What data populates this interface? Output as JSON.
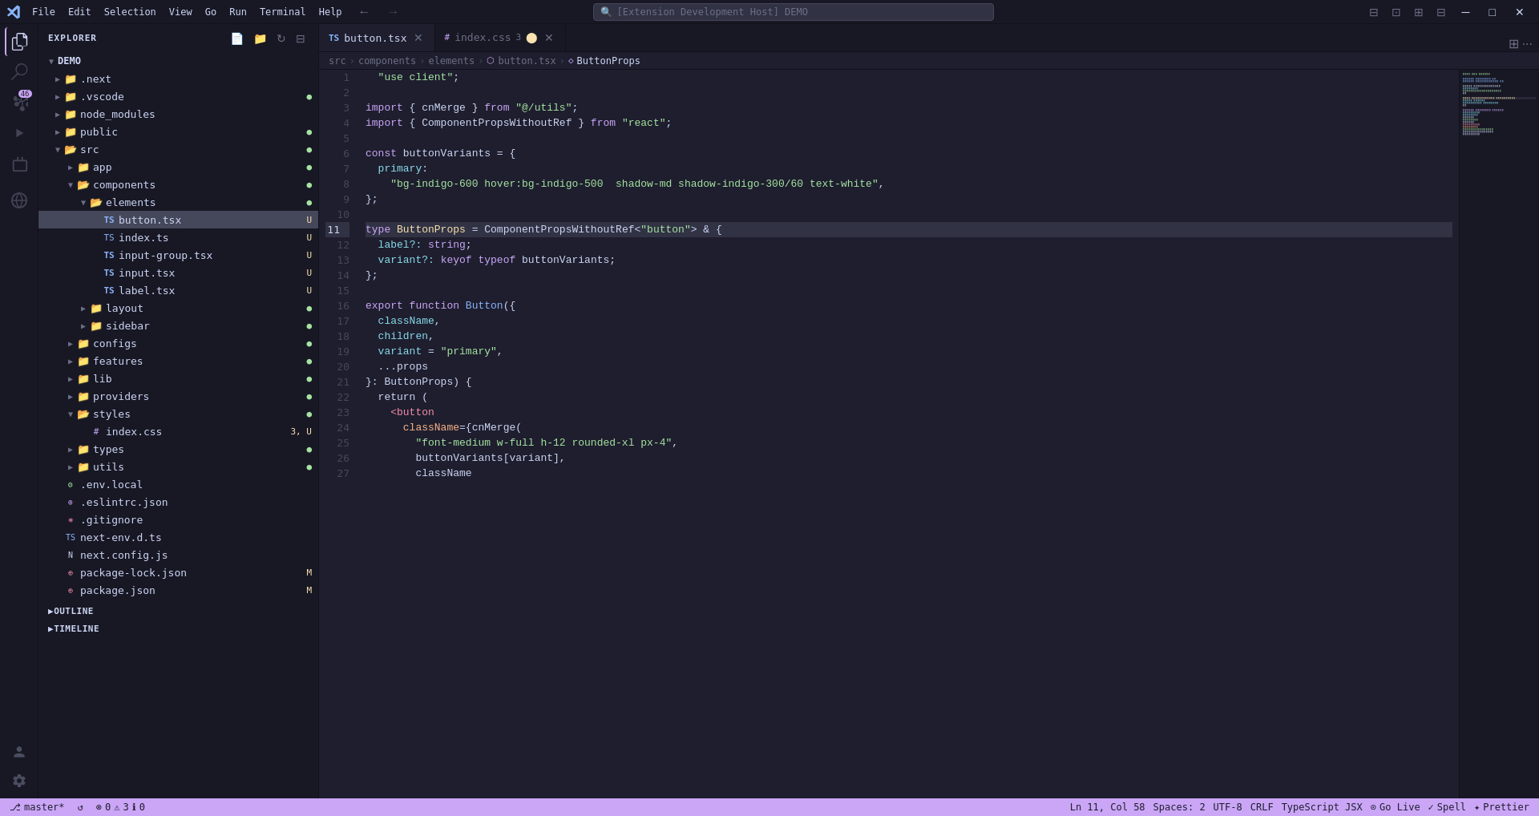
{
  "titlebar": {
    "menu_items": [
      "File",
      "Edit",
      "Selection",
      "View",
      "Go",
      "Run",
      "Terminal",
      "Help"
    ],
    "search_placeholder": "[Extension Development Host] DEMO",
    "nav_back": "←",
    "nav_forward": "→"
  },
  "activity_bar": {
    "icons": [
      {
        "name": "explorer-icon",
        "symbol": "⎘",
        "active": true,
        "badge": null
      },
      {
        "name": "search-icon",
        "symbol": "🔍",
        "active": false,
        "badge": null
      },
      {
        "name": "source-control-icon",
        "symbol": "⎇",
        "active": false,
        "badge": "46"
      },
      {
        "name": "run-debug-icon",
        "symbol": "▷",
        "active": false,
        "badge": null
      },
      {
        "name": "extensions-icon",
        "symbol": "⊞",
        "active": false,
        "badge": null
      },
      {
        "name": "remote-explorer-icon",
        "symbol": "⊡",
        "active": false,
        "badge": null
      }
    ],
    "bottom_icons": [
      {
        "name": "account-icon",
        "symbol": "👤"
      },
      {
        "name": "settings-icon",
        "symbol": "⚙"
      }
    ]
  },
  "sidebar": {
    "title": "EXPLORER",
    "root": "DEMO",
    "tree": [
      {
        "id": "next",
        "label": ".next",
        "type": "folder",
        "indent": 1,
        "expanded": false,
        "badge": ""
      },
      {
        "id": "vscode",
        "label": ".vscode",
        "type": "folder",
        "indent": 1,
        "expanded": false,
        "badge": "●",
        "badge_class": "badge-green"
      },
      {
        "id": "node_modules",
        "label": "node_modules",
        "type": "folder",
        "indent": 1,
        "expanded": false,
        "badge": ""
      },
      {
        "id": "public",
        "label": "public",
        "type": "folder",
        "indent": 1,
        "expanded": false,
        "badge": "●",
        "badge_class": "badge-green"
      },
      {
        "id": "src",
        "label": "src",
        "type": "folder",
        "indent": 1,
        "expanded": true,
        "badge": "●",
        "badge_class": "badge-green"
      },
      {
        "id": "app",
        "label": "app",
        "type": "folder",
        "indent": 2,
        "expanded": false,
        "badge": "●",
        "badge_class": "badge-green"
      },
      {
        "id": "components",
        "label": "components",
        "type": "folder",
        "indent": 2,
        "expanded": true,
        "badge": "●",
        "badge_class": "badge-green"
      },
      {
        "id": "elements",
        "label": "elements",
        "type": "folder",
        "indent": 3,
        "expanded": true,
        "badge": "●",
        "badge_class": "badge-green"
      },
      {
        "id": "button_tsx",
        "label": "button.tsx",
        "type": "tsx",
        "indent": 4,
        "expanded": false,
        "badge": "U",
        "badge_class": "badge-yellow"
      },
      {
        "id": "index_ts",
        "label": "index.ts",
        "type": "ts",
        "indent": 4,
        "expanded": false,
        "badge": "U",
        "badge_class": "badge-yellow"
      },
      {
        "id": "input_group_tsx",
        "label": "input-group.tsx",
        "type": "tsx",
        "indent": 4,
        "expanded": false,
        "badge": "U",
        "badge_class": "badge-yellow"
      },
      {
        "id": "input_tsx",
        "label": "input.tsx",
        "type": "tsx",
        "indent": 4,
        "expanded": false,
        "badge": "U",
        "badge_class": "badge-yellow"
      },
      {
        "id": "label_tsx",
        "label": "label.tsx",
        "type": "tsx",
        "indent": 4,
        "expanded": false,
        "badge": "U",
        "badge_class": "badge-yellow"
      },
      {
        "id": "layout",
        "label": "layout",
        "type": "folder",
        "indent": 3,
        "expanded": false,
        "badge": "●",
        "badge_class": "badge-green"
      },
      {
        "id": "sidebar_dir",
        "label": "sidebar",
        "type": "folder",
        "indent": 3,
        "expanded": false,
        "badge": "●",
        "badge_class": "badge-green"
      },
      {
        "id": "configs",
        "label": "configs",
        "type": "folder",
        "indent": 2,
        "expanded": false,
        "badge": "●",
        "badge_class": "badge-green"
      },
      {
        "id": "features",
        "label": "features",
        "type": "folder",
        "indent": 2,
        "expanded": false,
        "badge": "●",
        "badge_class": "badge-green"
      },
      {
        "id": "lib",
        "label": "lib",
        "type": "folder",
        "indent": 2,
        "expanded": false,
        "badge": "●",
        "badge_class": "badge-green"
      },
      {
        "id": "providers",
        "label": "providers",
        "type": "folder",
        "indent": 2,
        "expanded": false,
        "badge": "●",
        "badge_class": "badge-green"
      },
      {
        "id": "styles",
        "label": "styles",
        "type": "folder",
        "indent": 2,
        "expanded": true,
        "badge": "●",
        "badge_class": "badge-green"
      },
      {
        "id": "index_css",
        "label": "index.css",
        "type": "css",
        "indent": 3,
        "expanded": false,
        "badge": "3, U",
        "badge_class": "badge-yellow"
      },
      {
        "id": "types",
        "label": "types",
        "type": "folder",
        "indent": 2,
        "expanded": false,
        "badge": "●",
        "badge_class": "badge-green"
      },
      {
        "id": "utils",
        "label": "utils",
        "type": "folder",
        "indent": 2,
        "expanded": false,
        "badge": "●",
        "badge_class": "badge-green"
      },
      {
        "id": "env_local",
        "label": ".env.local",
        "type": "env",
        "indent": 1,
        "expanded": false,
        "badge": ""
      },
      {
        "id": "eslintrc",
        "label": ".eslintrc.json",
        "type": "json",
        "indent": 1,
        "expanded": false,
        "badge": ""
      },
      {
        "id": "gitignore",
        "label": ".gitignore",
        "type": "git",
        "indent": 1,
        "expanded": false,
        "badge": ""
      },
      {
        "id": "next_env",
        "label": "next-env.d.ts",
        "type": "ts",
        "indent": 1,
        "expanded": false,
        "badge": ""
      },
      {
        "id": "next_config",
        "label": "next.config.js",
        "type": "next",
        "indent": 1,
        "expanded": false,
        "badge": ""
      },
      {
        "id": "package_lock",
        "label": "package-lock.json",
        "type": "json",
        "indent": 1,
        "expanded": false,
        "badge": "M",
        "badge_class": "badge-yellow"
      },
      {
        "id": "package_json",
        "label": "package.json",
        "type": "json",
        "indent": 1,
        "expanded": false,
        "badge": "M",
        "badge_class": "badge-yellow"
      }
    ],
    "sections": [
      {
        "id": "outline",
        "label": "OUTLINE"
      },
      {
        "id": "timeline",
        "label": "TIMELINE"
      }
    ]
  },
  "tabs": [
    {
      "id": "button_tsx_tab",
      "label": "button.tsx",
      "type": "tsx",
      "active": true,
      "modified": false,
      "dirty": true
    },
    {
      "id": "index_css_tab",
      "label": "index.css",
      "type": "css",
      "active": false,
      "modified": true,
      "dirty": true,
      "count": "3"
    }
  ],
  "breadcrumb": {
    "items": [
      "src",
      "components",
      "elements",
      "button.tsx",
      "ButtonProps"
    ]
  },
  "code": {
    "highlighted_line": 11,
    "lines": [
      {
        "num": 1,
        "tokens": [
          {
            "text": "  \"use client\";",
            "class": "s-string"
          }
        ]
      },
      {
        "num": 2,
        "tokens": []
      },
      {
        "num": 3,
        "tokens": [
          {
            "text": "import ",
            "class": "s-keyword"
          },
          {
            "text": "{ cnMerge } ",
            "class": "s-plain"
          },
          {
            "text": "from ",
            "class": "s-keyword"
          },
          {
            "text": "\"@/utils\"",
            "class": "s-string"
          },
          {
            "text": ";",
            "class": "s-plain"
          }
        ]
      },
      {
        "num": 4,
        "tokens": [
          {
            "text": "import ",
            "class": "s-keyword"
          },
          {
            "text": "{ ComponentPropsWithoutRef } ",
            "class": "s-plain"
          },
          {
            "text": "from ",
            "class": "s-keyword"
          },
          {
            "text": "\"react\"",
            "class": "s-string"
          },
          {
            "text": ";",
            "class": "s-plain"
          }
        ]
      },
      {
        "num": 5,
        "tokens": []
      },
      {
        "num": 6,
        "tokens": [
          {
            "text": "const ",
            "class": "s-keyword"
          },
          {
            "text": "buttonVariants ",
            "class": "s-variable"
          },
          {
            "text": "= {",
            "class": "s-plain"
          }
        ]
      },
      {
        "num": 7,
        "tokens": [
          {
            "text": "  primary",
            "class": "s-property"
          },
          {
            "text": ":",
            "class": "s-plain"
          }
        ]
      },
      {
        "num": 8,
        "tokens": [
          {
            "text": "    \"bg-indigo-600 hover:bg-indigo-500  shadow-md shadow-indigo-300/60 text-white\"",
            "class": "s-string"
          },
          {
            "text": ",",
            "class": "s-plain"
          }
        ]
      },
      {
        "num": 9,
        "tokens": [
          {
            "text": "};",
            "class": "s-plain"
          }
        ]
      },
      {
        "num": 10,
        "tokens": []
      },
      {
        "num": 11,
        "tokens": [
          {
            "text": "type ",
            "class": "s-keyword"
          },
          {
            "text": "ButtonProps ",
            "class": "s-type"
          },
          {
            "text": "= ComponentPropsWithoutRef",
            "class": "s-plain"
          },
          {
            "text": "<\"button\"> & {",
            "class": "s-plain"
          }
        ]
      },
      {
        "num": 12,
        "tokens": [
          {
            "text": "  label",
            "class": "s-property"
          },
          {
            "text": "?: ",
            "class": "s-operator"
          },
          {
            "text": "string",
            "class": "s-keyword"
          },
          {
            "text": ";",
            "class": "s-plain"
          }
        ]
      },
      {
        "num": 13,
        "tokens": [
          {
            "text": "  variant",
            "class": "s-property"
          },
          {
            "text": "?: ",
            "class": "s-operator"
          },
          {
            "text": "keyof ",
            "class": "s-keyword"
          },
          {
            "text": "typeof ",
            "class": "s-keyword"
          },
          {
            "text": "buttonVariants",
            "class": "s-variable"
          },
          {
            "text": ";",
            "class": "s-plain"
          }
        ]
      },
      {
        "num": 14,
        "tokens": [
          {
            "text": "};",
            "class": "s-plain"
          }
        ]
      },
      {
        "num": 15,
        "tokens": []
      },
      {
        "num": 16,
        "tokens": [
          {
            "text": "export ",
            "class": "s-keyword"
          },
          {
            "text": "function ",
            "class": "s-keyword"
          },
          {
            "text": "Button",
            "class": "s-function"
          },
          {
            "text": "({",
            "class": "s-plain"
          }
        ]
      },
      {
        "num": 17,
        "tokens": [
          {
            "text": "  className",
            "class": "s-property"
          },
          {
            "text": ",",
            "class": "s-plain"
          }
        ]
      },
      {
        "num": 18,
        "tokens": [
          {
            "text": "  children",
            "class": "s-property"
          },
          {
            "text": ",",
            "class": "s-plain"
          }
        ]
      },
      {
        "num": 19,
        "tokens": [
          {
            "text": "  variant ",
            "class": "s-property"
          },
          {
            "text": "= ",
            "class": "s-operator"
          },
          {
            "text": "\"primary\"",
            "class": "s-string"
          },
          {
            "text": ",",
            "class": "s-plain"
          }
        ]
      },
      {
        "num": 20,
        "tokens": [
          {
            "text": "  ...props",
            "class": "s-plain"
          }
        ]
      },
      {
        "num": 21,
        "tokens": [
          {
            "text": "}: ButtonProps) {",
            "class": "s-plain"
          }
        ]
      },
      {
        "num": 22,
        "tokens": [
          {
            "text": "  return (",
            "class": "s-plain"
          }
        ]
      },
      {
        "num": 23,
        "tokens": [
          {
            "text": "    ",
            "class": "s-plain"
          },
          {
            "text": "<button",
            "class": "s-tag"
          }
        ]
      },
      {
        "num": 24,
        "tokens": [
          {
            "text": "      ",
            "class": "s-plain"
          },
          {
            "text": "className",
            "class": "s-attr"
          },
          {
            "text": "={cnMerge(",
            "class": "s-plain"
          }
        ]
      },
      {
        "num": 25,
        "tokens": [
          {
            "text": "        \"font-medium w-full h-12 rounded-xl px-4\"",
            "class": "s-string"
          },
          {
            "text": ",",
            "class": "s-plain"
          }
        ]
      },
      {
        "num": 26,
        "tokens": [
          {
            "text": "        buttonVariants[variant]",
            "class": "s-plain"
          },
          {
            "text": ",",
            "class": "s-plain"
          }
        ]
      },
      {
        "num": 27,
        "tokens": [
          {
            "text": "        className",
            "class": "s-plain"
          }
        ]
      }
    ]
  },
  "status_bar": {
    "branch": "master*",
    "sync_icon": "↺",
    "errors": "0",
    "warnings": "3",
    "infos": "0",
    "position": "Ln 11, Col 58",
    "spaces": "Spaces: 2",
    "encoding": "UTF-8",
    "line_ending": "CRLF",
    "language": "TypeScript JSX",
    "go_live": "Go Live",
    "spell": "Spell",
    "prettier": "Prettier"
  }
}
